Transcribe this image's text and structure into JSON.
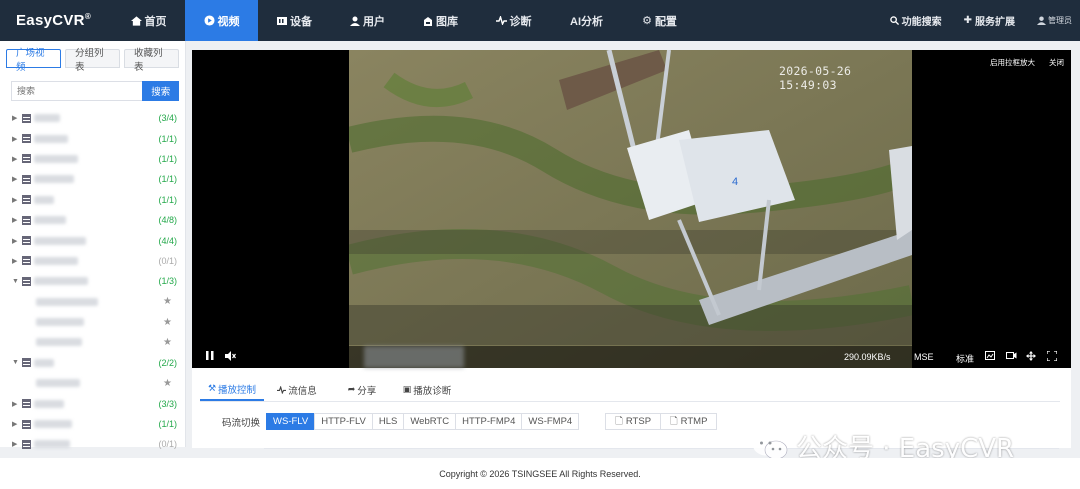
{
  "app": {
    "logo": "EasyCVR",
    "logo_mark": "®"
  },
  "nav": {
    "items": [
      {
        "label": "首页",
        "icon": "home-icon"
      },
      {
        "label": "视频",
        "icon": "play-circle-icon",
        "active": true
      },
      {
        "label": "设备",
        "icon": "device-icon"
      },
      {
        "label": "用户",
        "icon": "user-icon"
      },
      {
        "label": "图库",
        "icon": "gallery-icon"
      },
      {
        "label": "诊断",
        "icon": "pulse-icon"
      },
      {
        "label": "AI分析",
        "icon": ""
      },
      {
        "label": "配置",
        "icon": "gear-icon"
      }
    ],
    "feature_search": "功能搜索",
    "service_ext": "服务扩展",
    "user": "管理员"
  },
  "sidebar": {
    "tabs": [
      "广场视频",
      "分组列表",
      "收藏列表"
    ],
    "search_placeholder": "搜索",
    "search_button": "搜索",
    "tree": [
      {
        "count": "(3/4)",
        "expanded": false
      },
      {
        "count": "(1/1)",
        "expanded": false
      },
      {
        "count": "(1/1)",
        "expanded": false
      },
      {
        "count": "(1/1)",
        "expanded": false
      },
      {
        "count": "(1/1)",
        "expanded": false
      },
      {
        "count": "(4/8)",
        "expanded": false
      },
      {
        "count": "(4/4)",
        "expanded": false
      },
      {
        "count": "(0/1)",
        "expanded": false,
        "offline": true
      },
      {
        "count": "(1/3)",
        "expanded": true,
        "children": 3
      },
      {
        "count": "(2/2)",
        "expanded": true,
        "children": 1
      },
      {
        "count": "(3/3)",
        "expanded": false
      },
      {
        "count": "(1/1)",
        "expanded": false
      },
      {
        "count": "(0/1)",
        "expanded": false,
        "offline": true
      }
    ]
  },
  "player": {
    "timestamp": "2026-05-26 15:49:03",
    "enable_zoom": "启用拉框放大",
    "close": "关闭",
    "bitrate": "290.09KB/s",
    "mode": "MSE",
    "quality": "标准",
    "tabs": [
      "播放控制",
      "流信息",
      "分享",
      "播放诊断"
    ],
    "stream_switch_label": "码流切换",
    "streams": [
      "WS-FLV",
      "HTTP-FLV",
      "HLS",
      "WebRTC",
      "HTTP-FMP4",
      "WS-FMP4"
    ],
    "active_stream": "WS-FLV",
    "addresses": [
      "RTSP",
      "RTMP"
    ]
  },
  "footer": {
    "copyright": "Copyright © 2026 TSINGSEE All Rights Reserved."
  },
  "watermark": {
    "text": "公众号 · EasyCVR"
  },
  "colors": {
    "nav_bg": "#1f2d3d",
    "accent": "#2c7be5",
    "online": "#23a84a"
  }
}
